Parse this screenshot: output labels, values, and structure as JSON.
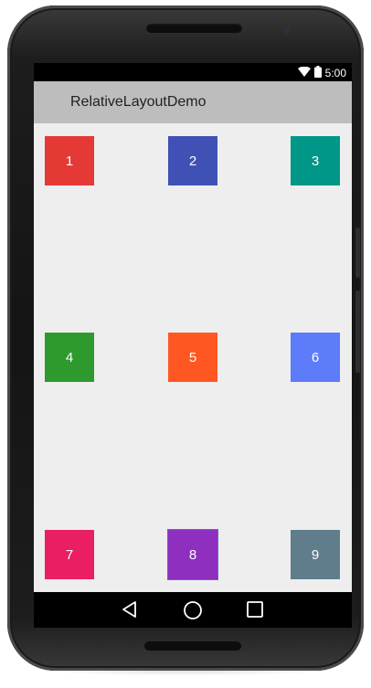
{
  "status_bar": {
    "time": "5:00",
    "icons": [
      "wifi-icon",
      "battery-icon"
    ]
  },
  "app_bar": {
    "title": "RelativeLayoutDemo"
  },
  "boxes": [
    {
      "label": "1",
      "color": "#e53935"
    },
    {
      "label": "2",
      "color": "#3f51b5"
    },
    {
      "label": "3",
      "color": "#009688"
    },
    {
      "label": "4",
      "color": "#2e9a2e"
    },
    {
      "label": "5",
      "color": "#ff5722"
    },
    {
      "label": "6",
      "color": "#5c7cfa"
    },
    {
      "label": "7",
      "color": "#e91e63"
    },
    {
      "label": "8",
      "color": "#8e2fc0"
    },
    {
      "label": "9",
      "color": "#607d8b"
    }
  ],
  "nav_bar": {
    "icons": [
      "back-icon",
      "home-icon",
      "recent-apps-icon"
    ]
  }
}
